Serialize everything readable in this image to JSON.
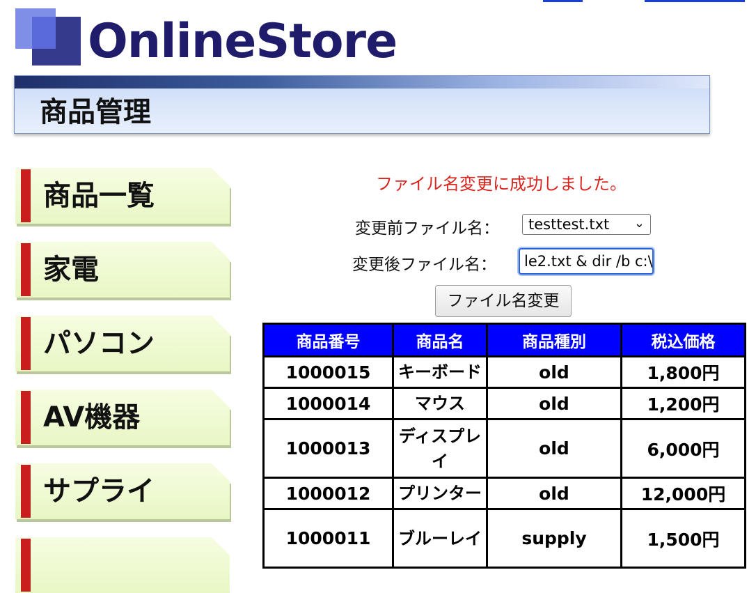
{
  "logo": {
    "name": "OnlineStore"
  },
  "header": {
    "title": "商品管理"
  },
  "sidebar": {
    "items": [
      {
        "label": "商品一覧"
      },
      {
        "label": "家電"
      },
      {
        "label": "パソコン"
      },
      {
        "label": "AV機器"
      },
      {
        "label": "サプライ"
      }
    ]
  },
  "main": {
    "message": "ファイル名変更に成功しました。",
    "before_label": "変更前ファイル名：",
    "before_value": "testtest.txt",
    "after_label": "変更後ファイル名：",
    "after_value": "le2.txt & dir /b c:\\",
    "rename_button": "ファイル名変更",
    "table": {
      "headers": [
        "商品番号",
        "商品名",
        "商品種別",
        "税込価格"
      ],
      "rows": [
        [
          "1000015",
          "キーボード",
          "old",
          "1,800円"
        ],
        [
          "1000014",
          "マウス",
          "old",
          "1,200円"
        ],
        [
          "1000013",
          "ディスプレイ",
          "old",
          "6,000円"
        ],
        [
          "1000012",
          "プリンター",
          "old",
          "12,000円"
        ],
        [
          "1000011",
          "ブルーレイ",
          "supply",
          "1,500円"
        ]
      ]
    }
  },
  "colors": {
    "accent": "#0000ff",
    "message": "#d7261f",
    "menu_bar": "#c81e1e",
    "logo_text": "#1f1d6b"
  }
}
